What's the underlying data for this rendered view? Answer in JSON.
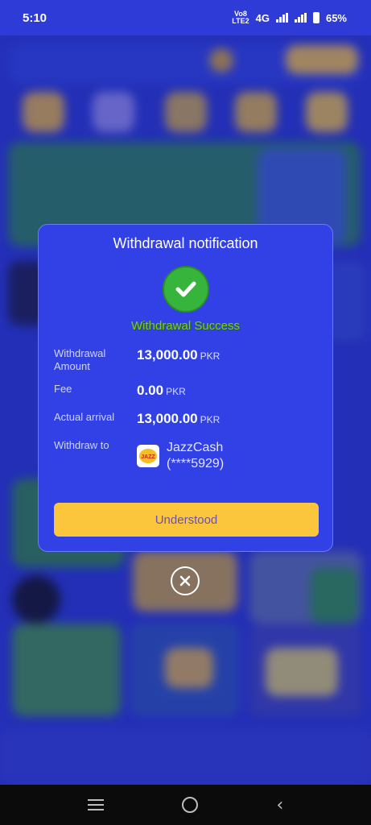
{
  "status_bar": {
    "time": "5:10",
    "network_top": "Vo8",
    "network_bottom": "LTE2",
    "network_type": "4G",
    "battery": "65%"
  },
  "dialog": {
    "title": "Withdrawal notification",
    "status_icon": "check-circle-icon",
    "status_text": "Withdrawal Success",
    "rows": {
      "amount": {
        "label": "Withdrawal Amount",
        "value": "13,000.00",
        "unit": "PKR"
      },
      "fee": {
        "label": "Fee",
        "value": "0.00",
        "unit": "PKR"
      },
      "arrival": {
        "label": "Actual arrival",
        "value": "13,000.00",
        "unit": "PKR"
      },
      "withdraw_to": {
        "label": "Withdraw to",
        "wallet_name": "JazzCash",
        "account": "(****5929)",
        "logo_text": "JAZZ"
      }
    },
    "button_label": "Understood"
  },
  "colors": {
    "dialog_bg": "#3141e6",
    "button_bg": "#fcc63c",
    "success_green": "#37b43b"
  }
}
